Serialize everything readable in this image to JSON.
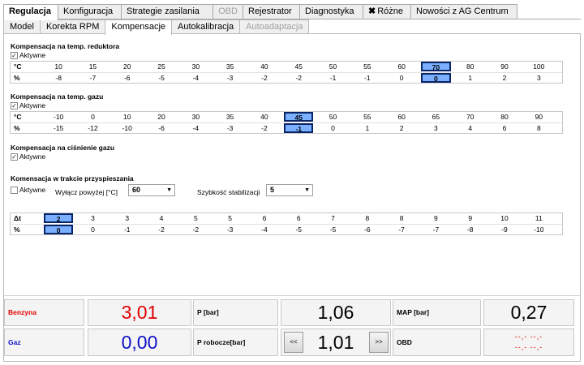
{
  "tabs_top": [
    "Regulacja",
    "Konfiguracja",
    "Strategie zasilania",
    "OBD",
    "Rejestrator",
    "Diagnostyka",
    "Różne",
    "Nowości z AG Centrum"
  ],
  "tabs_sub": [
    "Model",
    "Korekta RPM",
    "Kompensacje",
    "Autokalibracja",
    "Autoadaptacja"
  ],
  "sec1": {
    "title": "Kompensacja na temp. reduktora",
    "active_label": "Aktywne",
    "row1_head": "°C",
    "row2_head": "%",
    "row1": [
      "10",
      "15",
      "20",
      "25",
      "30",
      "35",
      "40",
      "45",
      "50",
      "55",
      "60",
      "70",
      "80",
      "90",
      "100"
    ],
    "row2": [
      "-8",
      "-7",
      "-6",
      "-5",
      "-4",
      "-3",
      "-2",
      "-2",
      "-1",
      "-1",
      "0",
      "0",
      "1",
      "2",
      "3"
    ]
  },
  "sec2": {
    "title": "Kompensacja na temp. gazu",
    "active_label": "Aktywne",
    "row1_head": "°C",
    "row2_head": "%",
    "row1": [
      "-10",
      "0",
      "10",
      "20",
      "30",
      "35",
      "40",
      "45",
      "50",
      "55",
      "60",
      "65",
      "70",
      "80",
      "90"
    ],
    "row2": [
      "-15",
      "-12",
      "-10",
      "-6",
      "-4",
      "-3",
      "-2",
      "-1",
      "0",
      "1",
      "2",
      "3",
      "4",
      "6",
      "8"
    ]
  },
  "sec3": {
    "title": "Kompensacja na ciśnienie gazu",
    "active_label": "Aktywne"
  },
  "sec4": {
    "title": "Komensacja w trakcie przyspieszania",
    "active_label": "Aktywne",
    "wylacz_label": "Wyłącz powyżej [°C]",
    "wylacz_value": "60",
    "szybkosc_label": "Szybkość stabilizacji",
    "szybkosc_value": "5",
    "row1_head": "Δt",
    "row2_head": "%",
    "row1": [
      "2",
      "3",
      "3",
      "4",
      "5",
      "5",
      "6",
      "6",
      "7",
      "8",
      "8",
      "9",
      "9",
      "10",
      "11"
    ],
    "row2": [
      "0",
      "0",
      "-1",
      "-2",
      "-2",
      "-3",
      "-4",
      "-5",
      "-5",
      "-6",
      "-7",
      "-7",
      "-8",
      "-9",
      "-10"
    ]
  },
  "status": {
    "benzyna_label": "Benzyna",
    "benzyna_value": "3,01",
    "gaz_label": "Gaz",
    "gaz_value": "0,00",
    "p_label": "P [bar]",
    "p_value": "1,06",
    "probocze_label": "P robocze[bar]",
    "probocze_value": "1,01",
    "map_label": "MAP [bar]",
    "map_value": "0,27",
    "obd_label": "OBD",
    "obd_line1": "--,- --,-",
    "obd_line2": "--,- --,-",
    "btn_prev": "<<",
    "btn_next": ">>"
  },
  "colors": {
    "selected": "#7ab0ff",
    "red": "#e00000",
    "blue": "#1010c8"
  },
  "icons": {
    "tools": "wrench-screwdriver-icon",
    "check": "checkmark-icon",
    "dropdown": "triangle-down-icon"
  }
}
